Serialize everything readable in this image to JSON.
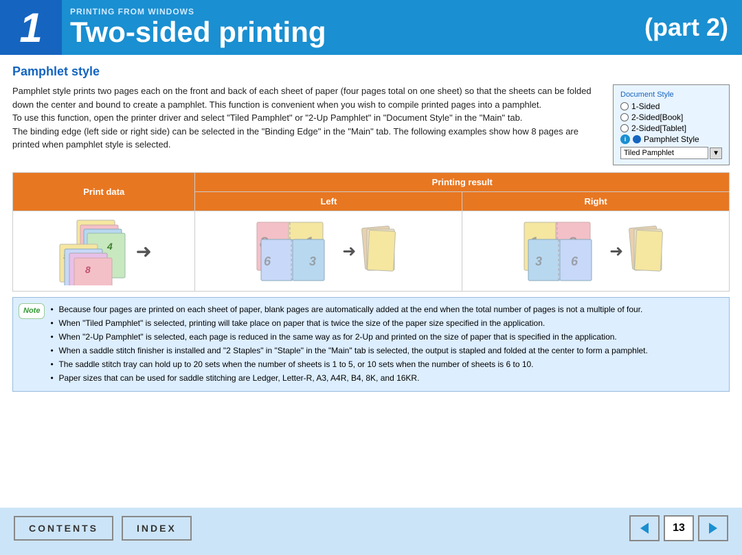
{
  "header": {
    "chapter_number": "1",
    "subtitle": "PRINTING FROM WINDOWS",
    "title": "Two-sided printing",
    "part": "(part 2)"
  },
  "section": {
    "title": "Pamphlet style",
    "body_paragraphs": [
      "Pamphlet style prints two pages each on the front and back of each sheet of paper (four pages total on one sheet) so that the sheets can be folded down the center and bound to create a pamphlet. This function is convenient when you wish to compile printed pages into a pamphlet.",
      "To use this function, open the printer driver and select \"Tiled Pamphlet\" or \"2-Up Pamphlet\" in \"Document Style\" in the \"Main\" tab.",
      "The binding edge (left side or right side) can be selected in the \"Binding Edge\" in the \"Main\" tab. The following examples show how 8 pages are printed when pamphlet style is selected."
    ]
  },
  "doc_style": {
    "title": "Document Style",
    "options": [
      {
        "label": "1-Sided",
        "selected": false
      },
      {
        "label": "2-Sided[Book]",
        "selected": false
      },
      {
        "label": "2-Sided[Tablet]",
        "selected": false
      },
      {
        "label": "Pamphlet Style",
        "selected": true,
        "has_info": true
      }
    ],
    "dropdown_value": "Tiled Pamphlet"
  },
  "print_table": {
    "header_print_data": "Print data",
    "header_printing_result": "Printing result",
    "col_left": "Left",
    "col_right": "Right"
  },
  "notes": [
    "Because four pages are printed on each sheet of paper, blank pages are automatically added at the end when the total number of pages is not a multiple of four.",
    "When \"Tiled Pamphlet\" is selected, printing will take place on paper that is twice the size of the paper size specified in the application.",
    "When \"2-Up Pamphlet\" is selected, each page is reduced in the same way as for 2-Up and printed on the size of paper that is specified in the application.",
    "When a saddle stitch finisher is installed and \"2 Staples\" in \"Staple\" in the \"Main\" tab is selected, the output is stapled and folded at the center to form a pamphlet.",
    "The saddle stitch tray can hold up to 20 sets when the number of sheets is 1 to 5, or 10 sets when the number of sheets is 6 to 10.",
    "Paper sizes that can be used for saddle stitching are Ledger, Letter-R, A3, A4R, B4, 8K, and 16KR."
  ],
  "footer": {
    "contents_label": "CONTENTS",
    "index_label": "INDEX",
    "page_number": "13",
    "prev_label": "◄",
    "next_label": "►"
  }
}
